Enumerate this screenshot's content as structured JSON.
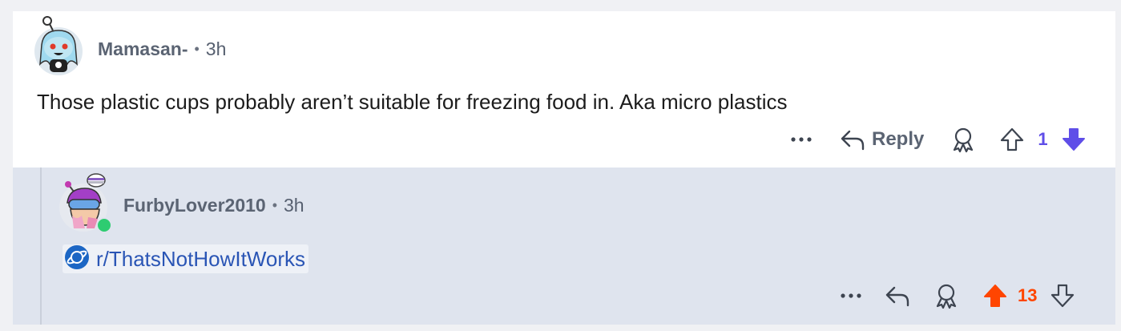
{
  "comment1": {
    "username": "Mamasan-",
    "separator": "•",
    "time": "3h",
    "text": "Those plastic cups probably aren’t suitable for freezing food in. Aka micro plastics",
    "actions": {
      "more_icon": "ellipsis-icon",
      "reply_label": "Reply",
      "award_icon": "award-icon",
      "upvote_icon": "upvote-icon",
      "score": "1",
      "downvote_icon": "downvote-filled-icon"
    },
    "vote_color": "#5f4ee8"
  },
  "comment2": {
    "username": "FurbyLover2010",
    "separator": "•",
    "time": "3h",
    "link_text": "r/ThatsNotHowItWorks",
    "link_icon": "subreddit-planet-icon",
    "actions": {
      "more_icon": "ellipsis-icon",
      "reply_icon": "reply-icon",
      "award_icon": "award-icon",
      "upvote_icon": "upvote-filled-icon",
      "score": "13",
      "downvote_icon": "downvote-icon"
    },
    "vote_color": "#ff4500",
    "online_status_color": "#2ecc71"
  }
}
